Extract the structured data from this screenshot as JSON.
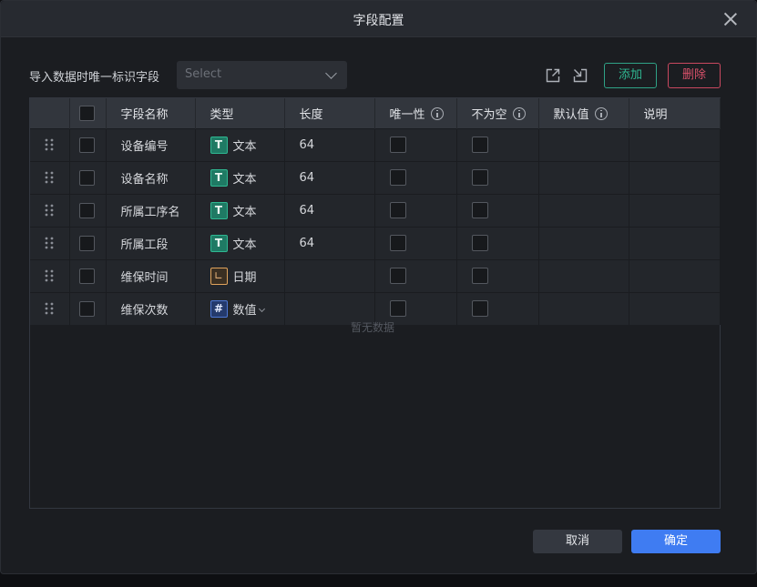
{
  "dialog": {
    "title": "字段配置",
    "close_icon": "close-icon"
  },
  "toolbar": {
    "unique_label": "导入数据时唯一标识字段",
    "select_placeholder": "Select",
    "export_icon": "export-icon",
    "import_icon": "import-icon",
    "add_label": "添加",
    "delete_label": "删除"
  },
  "table": {
    "headers": {
      "name": "字段名称",
      "type": "类型",
      "length": "长度",
      "unique": "唯一性",
      "not_null": "不为空",
      "default": "默认值",
      "description": "说明"
    },
    "rows": [
      {
        "name": "设备编号",
        "type": "文本",
        "type_kind": "text",
        "type_glyph": "T",
        "length": "64"
      },
      {
        "name": "设备名称",
        "type": "文本",
        "type_kind": "text",
        "type_glyph": "T",
        "length": "64"
      },
      {
        "name": "所属工序名",
        "type": "文本",
        "type_kind": "text",
        "type_glyph": "T",
        "length": "64"
      },
      {
        "name": "所属工段",
        "type": "文本",
        "type_kind": "text",
        "type_glyph": "T",
        "length": "64"
      },
      {
        "name": "维保时间",
        "type": "日期",
        "type_kind": "date",
        "type_glyph": "∟",
        "length": ""
      },
      {
        "name": "维保次数",
        "type": "数值",
        "type_kind": "number",
        "type_glyph": "#",
        "length": ""
      }
    ],
    "empty_text": "暂无数据"
  },
  "footer": {
    "cancel_label": "取消",
    "ok_label": "确定"
  },
  "colors": {
    "accent_blue": "#3f7cf2",
    "add_green": "#2fb892",
    "delete_red": "#d9516a",
    "date_orange": "#e0a35c"
  }
}
